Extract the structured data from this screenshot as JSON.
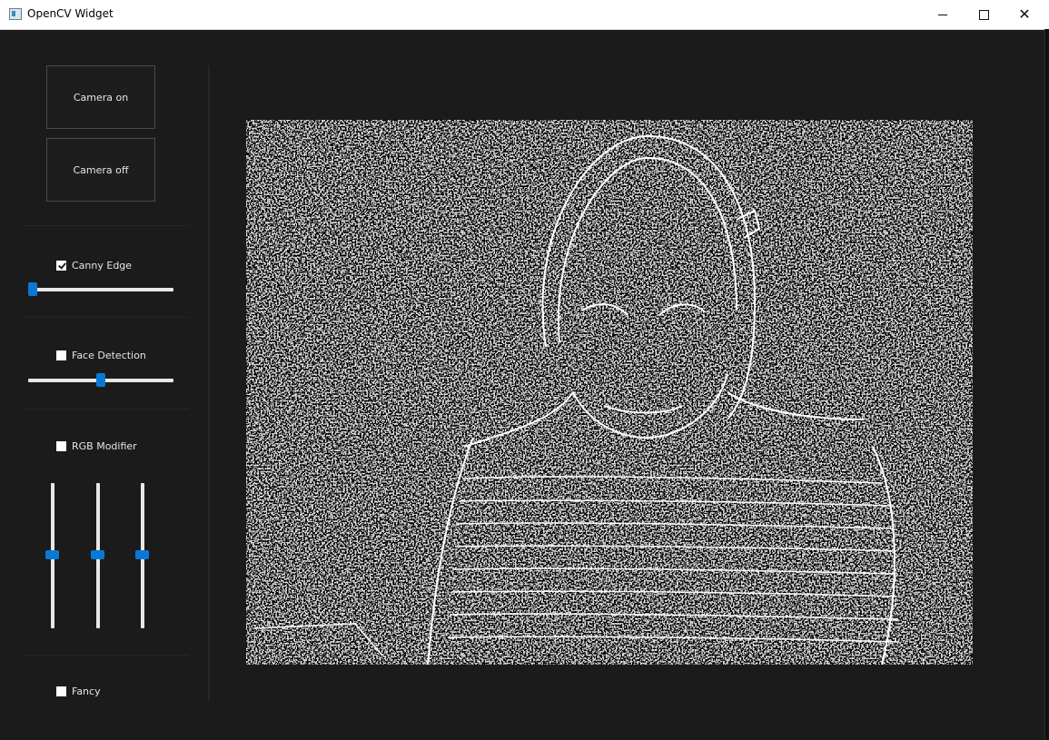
{
  "window": {
    "title": "OpenCV Widget"
  },
  "buttons": {
    "camera_on": "Camera on",
    "camera_off": "Camera off"
  },
  "controls": {
    "canny": {
      "label": "Canny Edge",
      "checked": true,
      "slider_value": 0.03
    },
    "face": {
      "label": "Face Detection",
      "checked": false,
      "slider_value": 0.5
    },
    "rgb": {
      "label": "RGB Modifier",
      "checked": false,
      "r": 0.5,
      "g": 0.5,
      "b": 0.5
    },
    "fancy": {
      "label": "Fancy",
      "checked": false
    }
  },
  "colors": {
    "accent": "#0a78d4",
    "background": "#1b1b1b"
  },
  "icons": {
    "minimize": "minimize-icon",
    "maximize": "maximize-icon",
    "close": "close-icon",
    "app": "app-icon"
  }
}
